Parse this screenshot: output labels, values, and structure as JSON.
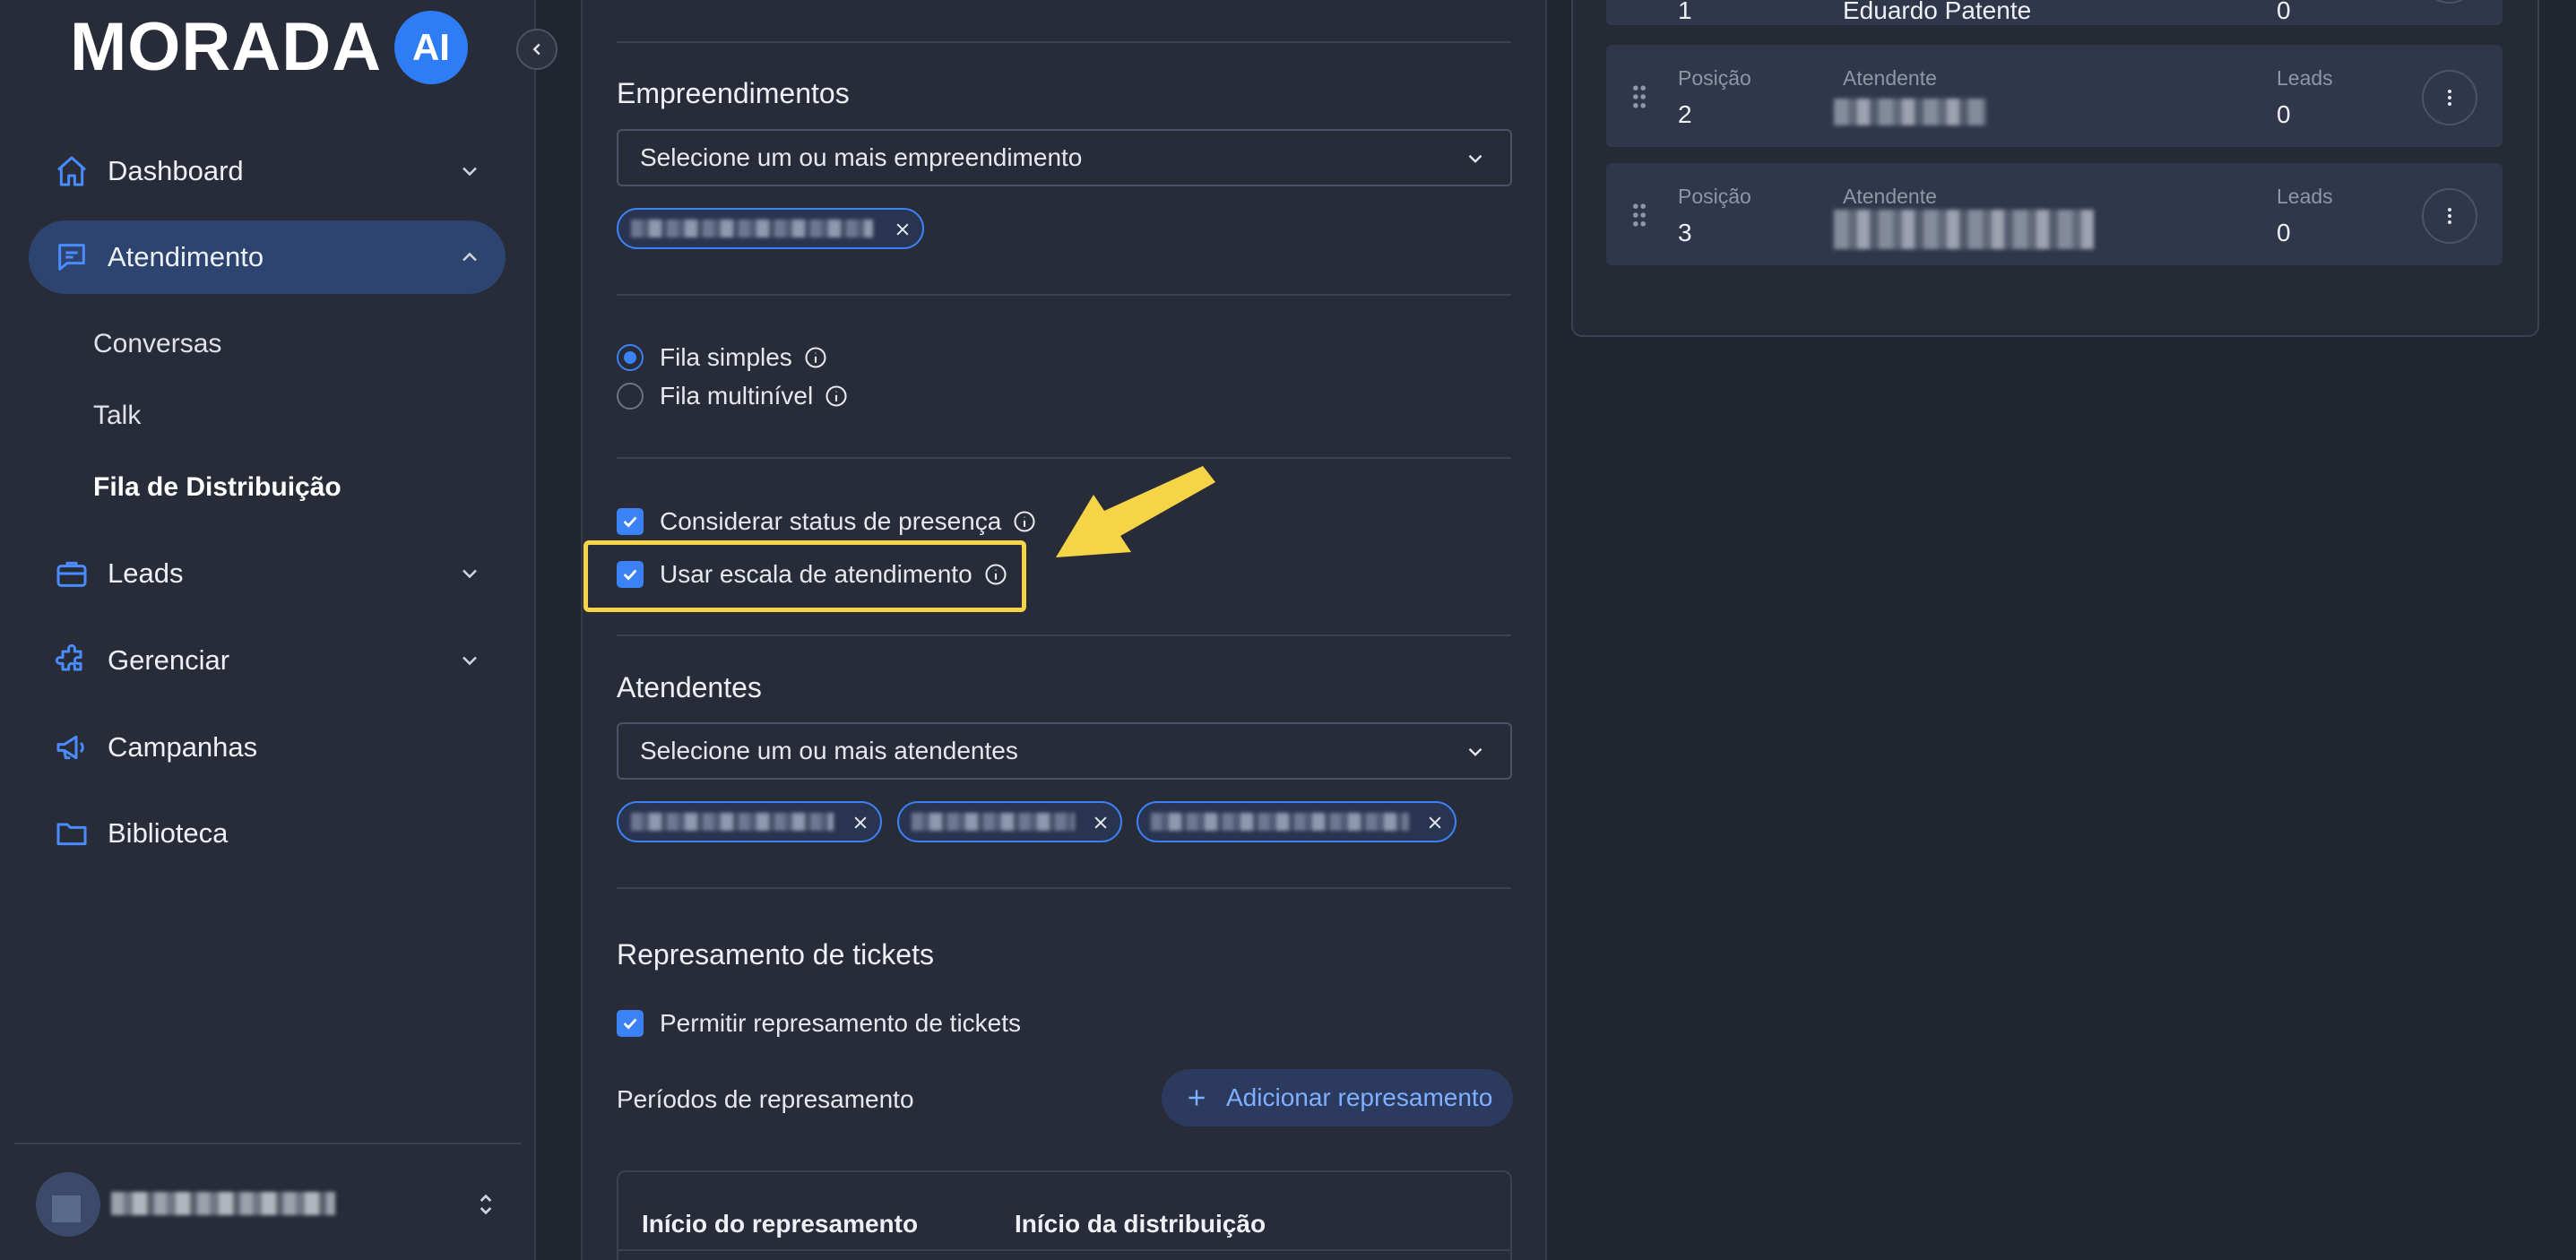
{
  "brand": {
    "logo_text": "MORADA",
    "badge": "AI"
  },
  "sidebar": {
    "nav": [
      {
        "label": "Dashboard",
        "icon": "home-icon"
      },
      {
        "label": "Atendimento",
        "icon": "chat-icon"
      },
      {
        "label": "Leads",
        "icon": "briefcase-icon"
      },
      {
        "label": "Gerenciar",
        "icon": "puzzle-icon"
      },
      {
        "label": "Campanhas",
        "icon": "megaphone-icon"
      },
      {
        "label": "Biblioteca",
        "icon": "folder-icon"
      }
    ],
    "subitems": [
      "Conversas",
      "Talk",
      "Fila de Distribuição"
    ]
  },
  "form": {
    "empreendimentos": {
      "title": "Empreendimentos",
      "placeholder": "Selecione um ou mais empreendimento"
    },
    "queue_type": {
      "simple": "Fila simples",
      "multilevel": "Fila multinível"
    },
    "options": {
      "presence": "Considerar status de presença",
      "schedule": "Usar escala de atendimento"
    },
    "atendentes": {
      "title": "Atendentes",
      "placeholder": "Selecione um ou mais atendentes"
    },
    "represamento": {
      "title": "Represamento de tickets",
      "allow": "Permitir represamento de tickets",
      "periods_label": "Períodos de represamento",
      "add_button": "Adicionar represamento",
      "col_start": "Início do represamento",
      "col_distribution": "Início da distribuição"
    }
  },
  "queue": {
    "labels": {
      "position": "Posição",
      "attendant": "Atendente",
      "leads": "Leads"
    },
    "top_row": {
      "position": "1",
      "attendant": "Eduardo Patente",
      "leads": "0"
    },
    "rows": [
      {
        "position": "2",
        "leads": "0"
      },
      {
        "position": "3",
        "leads": "0"
      }
    ]
  },
  "colors": {
    "accent": "#3b82f6",
    "highlight": "#f5d547",
    "active_nav": "#2d4470"
  }
}
